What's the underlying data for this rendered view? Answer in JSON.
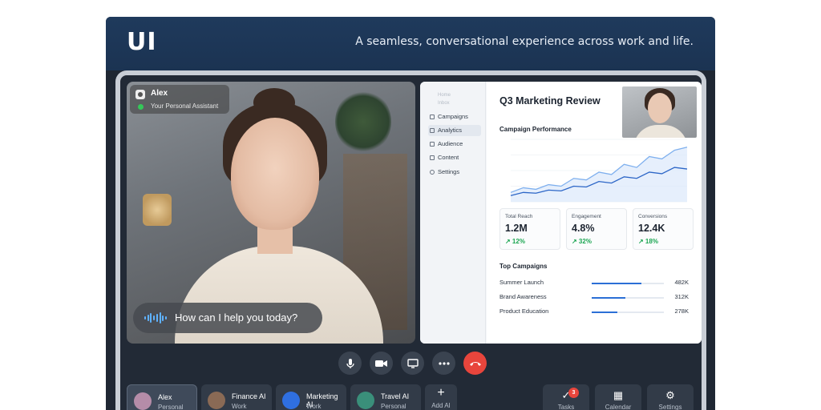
{
  "header": {
    "logo": "UI",
    "tagline": "A seamless, conversational experience across work and life."
  },
  "video": {
    "name": "Alex",
    "role": "Your Personal Assistant",
    "status_color": "#35c759",
    "caption": "How can I help you today?"
  },
  "screen_share": {
    "sidebar": {
      "faint_items": [
        "Home",
        "Inbox"
      ],
      "items": [
        {
          "label": "Campaigns",
          "active": false
        },
        {
          "label": "Analytics",
          "active": true
        },
        {
          "label": "Audience",
          "active": false
        },
        {
          "label": "Content",
          "active": false
        },
        {
          "label": "Settings",
          "active": false
        }
      ]
    },
    "title": "Q3 Marketing Review",
    "chart_title": "Campaign Performance",
    "kpis": [
      {
        "label": "Total Reach",
        "value": "1.2M",
        "change": "↗ 12%"
      },
      {
        "label": "Engagement",
        "value": "4.8%",
        "change": "↗ 32%"
      },
      {
        "label": "Conversions",
        "value": "12.4K",
        "change": "↗ 18%"
      }
    ],
    "top_campaigns_title": "Top Campaigns",
    "top_campaigns": [
      {
        "name": "Summer Launch",
        "value": "482K",
        "share": 0.69
      },
      {
        "name": "Brand Awareness",
        "value": "312K",
        "share": 0.47
      },
      {
        "name": "Product Education",
        "value": "278K",
        "share": 0.35
      }
    ],
    "chart_data": {
      "type": "line",
      "series": [
        {
          "values": [
            12,
            18,
            16,
            22,
            20,
            30,
            28,
            38,
            35,
            48,
            44,
            58,
            55,
            66,
            70
          ]
        },
        {
          "values": [
            8,
            12,
            11,
            15,
            14,
            20,
            19,
            26,
            24,
            32,
            30,
            38,
            36,
            44,
            42
          ]
        }
      ],
      "ylim": [
        0,
        80
      ],
      "grid": true
    }
  },
  "controls": {
    "mic_icon": "microphone-icon",
    "camera_icon": "video-camera-icon",
    "screen_icon": "screen-share-icon",
    "more_icon": "more-dots-icon",
    "end_icon": "end-call-icon",
    "end_color": "#e8453c"
  },
  "assistants": [
    {
      "name": "Alex",
      "role": "Personal",
      "color": "#b58ca8",
      "active": true
    },
    {
      "name": "Finance AI",
      "role": "Work",
      "color": "#8a6a55",
      "active": false
    },
    {
      "name": "Marketing AI",
      "role": "Work",
      "color": "#2f6fe0",
      "active": false
    },
    {
      "name": "Travel AI",
      "role": "Personal",
      "color": "#3a8f7a",
      "active": false
    }
  ],
  "add_label": "Add AI",
  "tools": [
    {
      "label": "Tasks",
      "icon": "✓",
      "badge": "3"
    },
    {
      "label": "Calendar",
      "icon": "▦",
      "badge": null
    },
    {
      "label": "Settings",
      "icon": "⚙",
      "badge": null
    }
  ]
}
